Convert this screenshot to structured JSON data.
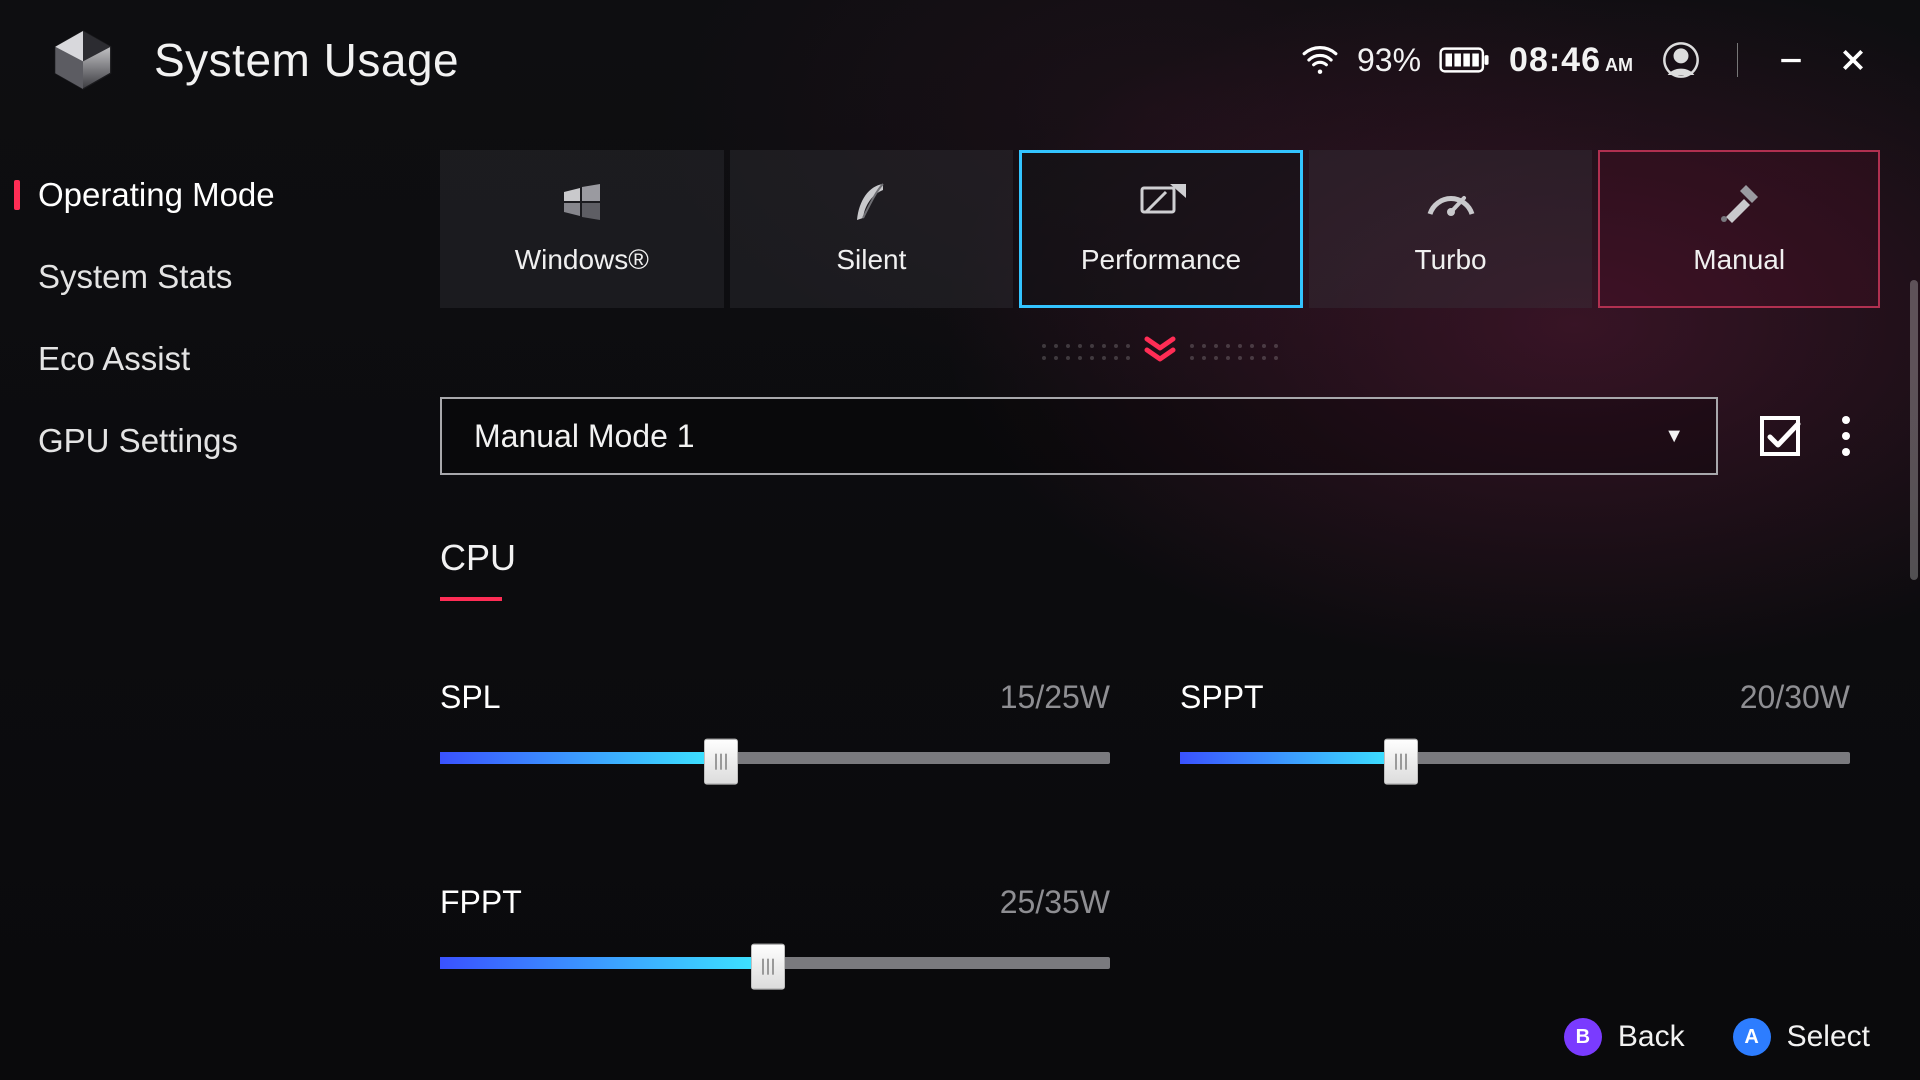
{
  "header": {
    "title": "System Usage",
    "battery_pct": "93%",
    "clock_time": "08:46",
    "clock_ampm": "AM"
  },
  "sidebar": {
    "items": [
      {
        "label": "Operating Mode",
        "active": true
      },
      {
        "label": "System Stats",
        "active": false
      },
      {
        "label": "Eco Assist",
        "active": false
      },
      {
        "label": "GPU Settings",
        "active": false
      }
    ]
  },
  "modes": [
    {
      "label": "Windows®",
      "icon": "windows",
      "selected": false,
      "active_profile": false
    },
    {
      "label": "Silent",
      "icon": "feather",
      "selected": false,
      "active_profile": false
    },
    {
      "label": "Performance",
      "icon": "gauge-flag",
      "selected": true,
      "active_profile": false
    },
    {
      "label": "Turbo",
      "icon": "speedometer",
      "selected": false,
      "active_profile": false
    },
    {
      "label": "Manual",
      "icon": "tools",
      "selected": false,
      "active_profile": true
    }
  ],
  "preset": {
    "selected": "Manual Mode 1"
  },
  "section": {
    "title": "CPU"
  },
  "sliders": [
    {
      "name": "SPL",
      "value": 15,
      "max": 25,
      "unit": "W",
      "display": "15/25W",
      "pct": 42
    },
    {
      "name": "SPPT",
      "value": 20,
      "max": 30,
      "unit": "W",
      "display": "20/30W",
      "pct": 33
    },
    {
      "name": "FPPT",
      "value": 25,
      "max": 35,
      "unit": "W",
      "display": "25/35W",
      "pct": 49
    }
  ],
  "footer": {
    "back": {
      "key": "B",
      "label": "Back"
    },
    "select": {
      "key": "A",
      "label": "Select"
    }
  }
}
